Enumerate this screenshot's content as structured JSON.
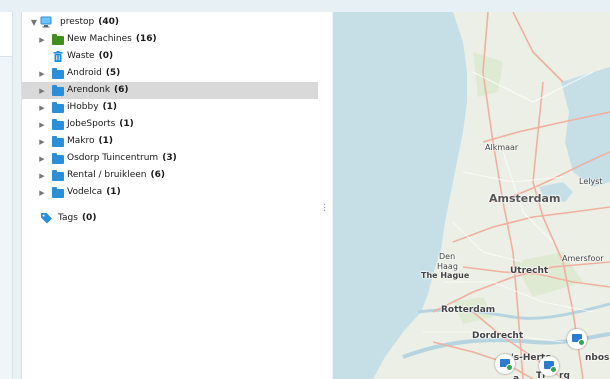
{
  "tree": {
    "root": {
      "label": "prestop",
      "count": "(40)"
    },
    "items": [
      {
        "label": "New Machines",
        "count": "(16)",
        "icon": "green-folder-icon",
        "color": "#3f8f1f",
        "expandable": true
      },
      {
        "label": "Waste",
        "count": "(0)",
        "icon": "trash-icon",
        "color": "#1b8ee0",
        "expandable": false
      },
      {
        "label": "Android",
        "count": "(5)",
        "icon": "folder-icon",
        "color": "#2a8fd8",
        "expandable": true
      },
      {
        "label": "Arendonk",
        "count": "(6)",
        "icon": "folder-icon",
        "color": "#2a8fd8",
        "expandable": true,
        "selected": true
      },
      {
        "label": "iHobby",
        "count": "(1)",
        "icon": "folder-icon",
        "color": "#2a8fd8",
        "expandable": true
      },
      {
        "label": "JobeSports",
        "count": "(1)",
        "icon": "folder-icon",
        "color": "#2a8fd8",
        "expandable": true
      },
      {
        "label": "Makro",
        "count": "(1)",
        "icon": "folder-icon",
        "color": "#2a8fd8",
        "expandable": true
      },
      {
        "label": "Osdorp Tuincentrum",
        "count": "(3)",
        "icon": "folder-icon",
        "color": "#2a8fd8",
        "expandable": true
      },
      {
        "label": "Rental / bruikleen",
        "count": "(6)",
        "icon": "folder-icon",
        "color": "#2a8fd8",
        "expandable": true
      },
      {
        "label": "Vodelca",
        "count": "(1)",
        "icon": "folder-icon",
        "color": "#2a8fd8",
        "expandable": true
      }
    ],
    "tags": {
      "label": "Tags",
      "count": "(0)",
      "icon": "tag-icon"
    }
  },
  "map": {
    "cities": [
      {
        "name": "Alkmaar",
        "weight": "normal",
        "size": 8
      },
      {
        "name": "Amsterdam",
        "weight": "bold",
        "size": 11
      },
      {
        "name": "Lelyst",
        "weight": "normal",
        "size": 8
      },
      {
        "name": "Den",
        "weight": "normal",
        "size": 8
      },
      {
        "name": "Haag",
        "weight": "normal",
        "size": 8
      },
      {
        "name": "The Hague",
        "weight": "bold",
        "size": 8
      },
      {
        "name": "Utrecht",
        "weight": "bold",
        "size": 9
      },
      {
        "name": "Amersfoor",
        "weight": "normal",
        "size": 8
      },
      {
        "name": "Rotterdam",
        "weight": "bold",
        "size": 9
      },
      {
        "name": "Dordrecht",
        "weight": "bold",
        "size": 9
      },
      {
        "name": "'s-Herto",
        "weight": "bold",
        "size": 9
      },
      {
        "name": "nbos",
        "weight": "bold",
        "size": 9
      },
      {
        "name": "Ti",
        "weight": "bold",
        "size": 9
      },
      {
        "name": "rg",
        "weight": "bold",
        "size": 9
      },
      {
        "name": "a",
        "weight": "bold",
        "size": 9
      }
    ],
    "markers": [
      {
        "name": "machine-marker-1",
        "icon": "computer-icon"
      },
      {
        "name": "machine-marker-2",
        "icon": "computer-icon"
      },
      {
        "name": "machine-marker-3",
        "icon": "computer-icon"
      }
    ],
    "colors": {
      "land": "#ecefe6",
      "water": "#c6dfe6",
      "roads": "#f0b0a0",
      "minor_roads": "#ffffff"
    }
  }
}
